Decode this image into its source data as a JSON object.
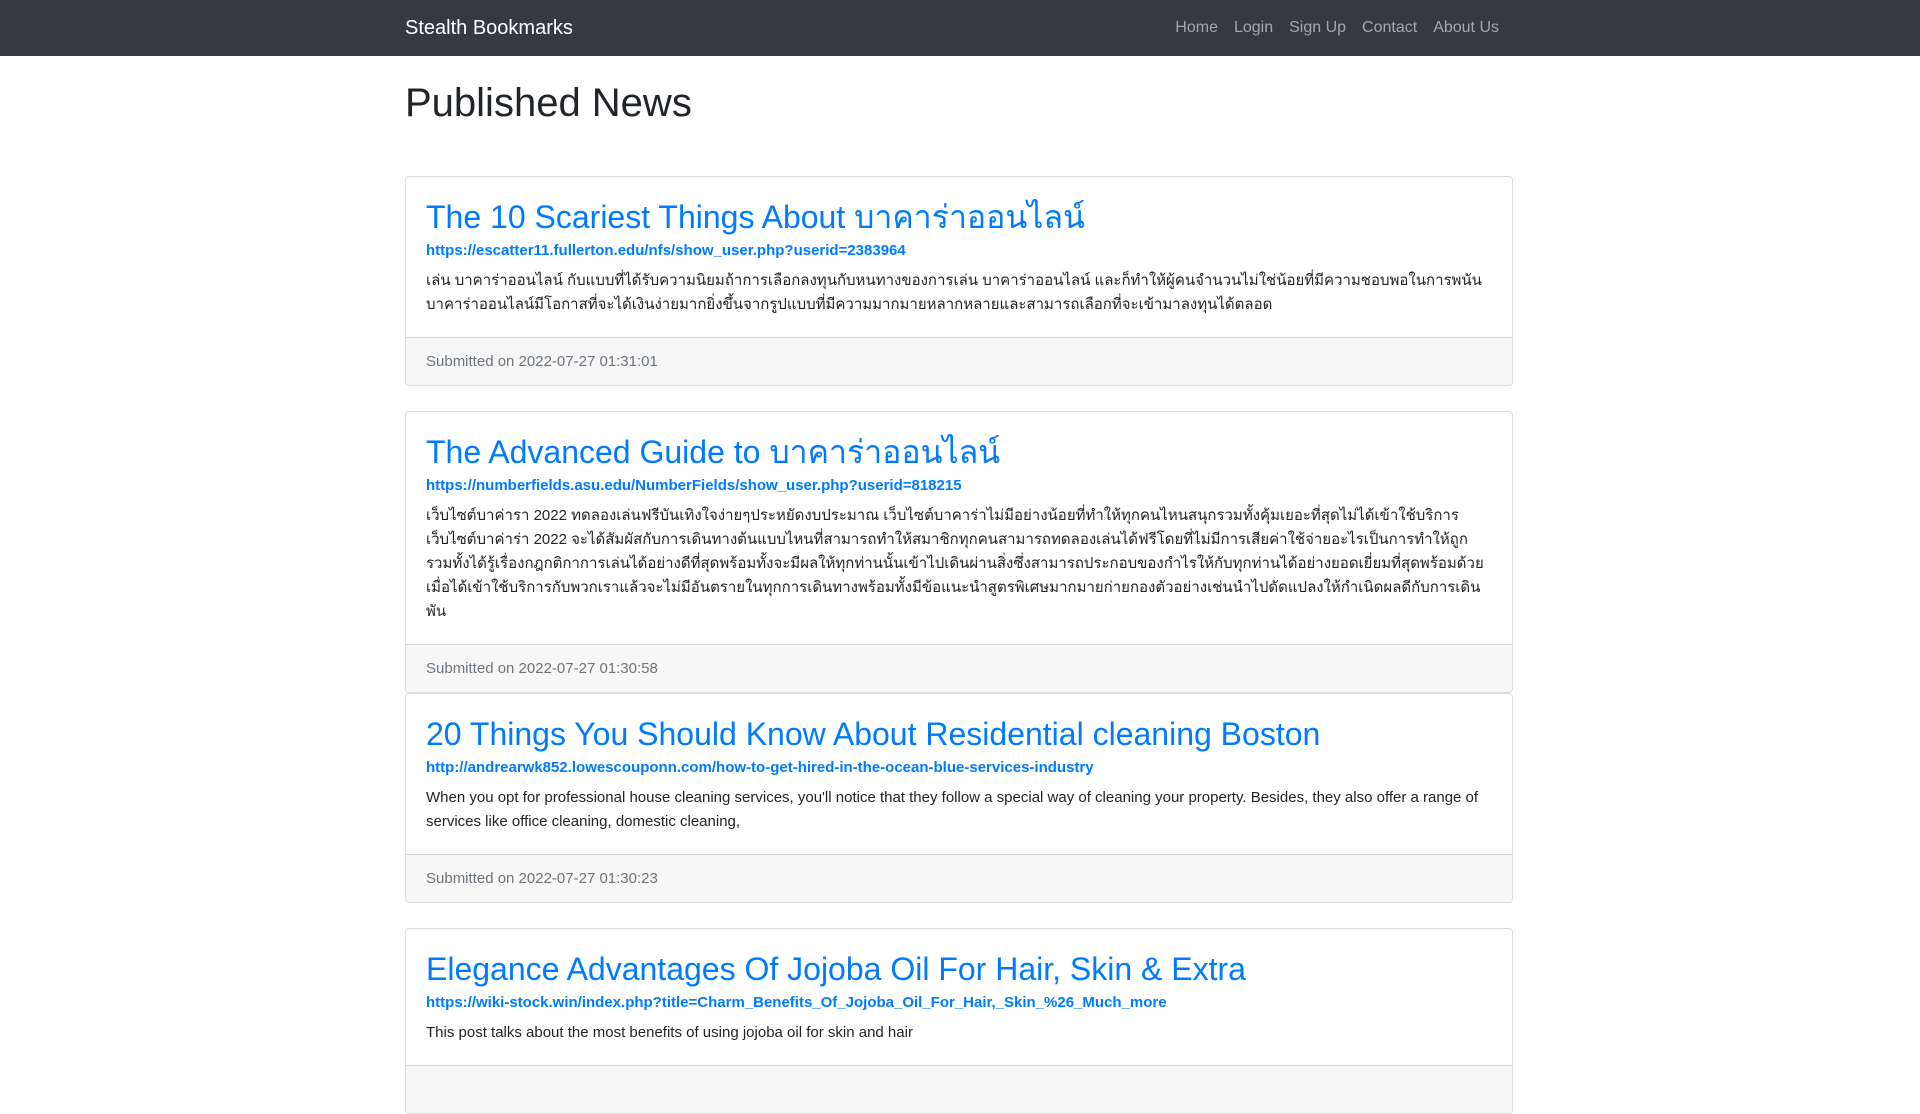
{
  "navbar": {
    "brand": "Stealth Bookmarks",
    "links": [
      "Home",
      "Login",
      "Sign Up",
      "Contact",
      "About Us"
    ]
  },
  "page": {
    "title": "Published News"
  },
  "posts": [
    {
      "title": "The 10 Scariest Things About บาคาร่าออนไลน์",
      "url": "https://escatter11.fullerton.edu/nfs/show_user.php?userid=2383964",
      "summary": "เล่น บาคาร่าออนไลน์ กับแบบที่ได้รับความนิยมถ้าการเลือกลงทุนกับหนทางของการเล่น บาคาร่าออนไลน์ และก็ทำให้ผู้คนจำนวนไม่ใช่น้อยที่มีความชอบพอในการพนันบาคาร่าออนไลน์มีโอกาสที่จะได้เงินง่ายมากยิ่งขึ้นจากรูปแบบที่มีความมากมายหลากหลายและสามารถเลือกที่จะเข้ามาลงทุนได้ตลอด",
      "submitted": "Submitted on 2022-07-27 01:31:01"
    },
    {
      "title": "The Advanced Guide to บาคาร่าออนไลน์",
      "url": "https://numberfields.asu.edu/NumberFields/show_user.php?userid=818215",
      "summary": "เว็บไซต์บาค่ารา 2022 ทดลองเล่นฟรีบันเทิงใจง่ายๆประหยัดงบประมาณ เว็บไซต์บาคาร่าไม่มีอย่างน้อยที่ทำให้ทุกคนไหนสนุกรวมทั้งคุ้มเยอะที่สุดไม่ได้เข้าใช้บริการ เว็บไซต์บาค่าร่า 2022 จะได้สัมผัสกับการเดินทางต้นแบบไหนที่สามารถทำให้สมาชิกทุกคนสามารถทดลองเล่นได้ฟรีโดยที่ไม่มีการเสียค่าใช้จ่ายอะไรเป็นการทำให้ถูกรวมทั้งได้รู้เรื่องกฎกติกาการเล่นได้อย่างดีที่สุดพร้อมทั้งจะมีผลให้ทุกท่านนั้นเข้าไปเดินผ่านสิ่งซึ่งสามารถประกอบของกำไรให้กับทุกท่านได้อย่างยอดเยี่ยมที่สุดพร้อมด้วยเมื่อได้เข้าใช้บริการกับพวกเราแล้วจะไม่มีอันตรายในทุกการเดินทางพร้อมทั้งมีข้อแนะนำสูตรพิเศษมากมายก่ายกองตัวอย่างเช่นนำไปดัดแปลงให้กำเนิดผลดีกับการเดินพัน",
      "submitted": "Submitted on 2022-07-27 01:30:58"
    },
    {
      "title": "20 Things You Should Know About Residential cleaning Boston",
      "url": "http://andrearwk852.lowescouponn.com/how-to-get-hired-in-the-ocean-blue-services-industry",
      "summary": "When you opt for professional house cleaning services, you'll notice that they follow a special way of cleaning your property. Besides, they also offer a range of services like office cleaning, domestic cleaning,",
      "submitted": "Submitted on 2022-07-27 01:30:23"
    },
    {
      "title": "Elegance Advantages Of Jojoba Oil For Hair, Skin & Extra",
      "url": "https://wiki-stock.win/index.php?title=Charm_Benefits_Of_Jojoba_Oil_For_Hair,_Skin_%26_Much_more",
      "summary": "This post talks about the most benefits of using jojoba oil for skin and hair",
      "submitted": ""
    }
  ],
  "colors": {
    "navbar_bg": "#343a40",
    "link": "#007bff",
    "footer_bg": "#f7f7f7",
    "muted": "#6c757d"
  }
}
